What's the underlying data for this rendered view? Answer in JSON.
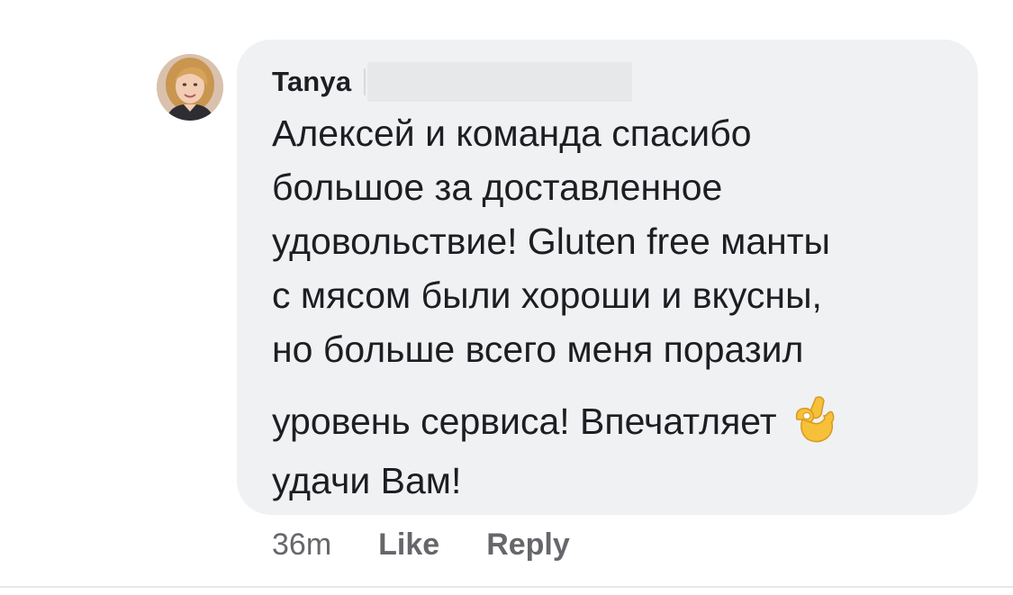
{
  "comment": {
    "author": "Tanya",
    "lines": [
      "Алексей и команда спасибо",
      "большое за доставленное",
      "удовольствие! Gluten free манты",
      "с мясом были хороши и вкусны,",
      "но больше всего меня поразил",
      "уровень сервиса! Впечатляет",
      "удачи Вам!"
    ],
    "emoji": "ok-hand-emoji"
  },
  "actions": {
    "time": "36m",
    "like_label": "Like",
    "reply_label": "Reply"
  },
  "colors": {
    "bubble": "#f0f1f3",
    "text": "#1c1e21",
    "meta": "#65676b"
  }
}
